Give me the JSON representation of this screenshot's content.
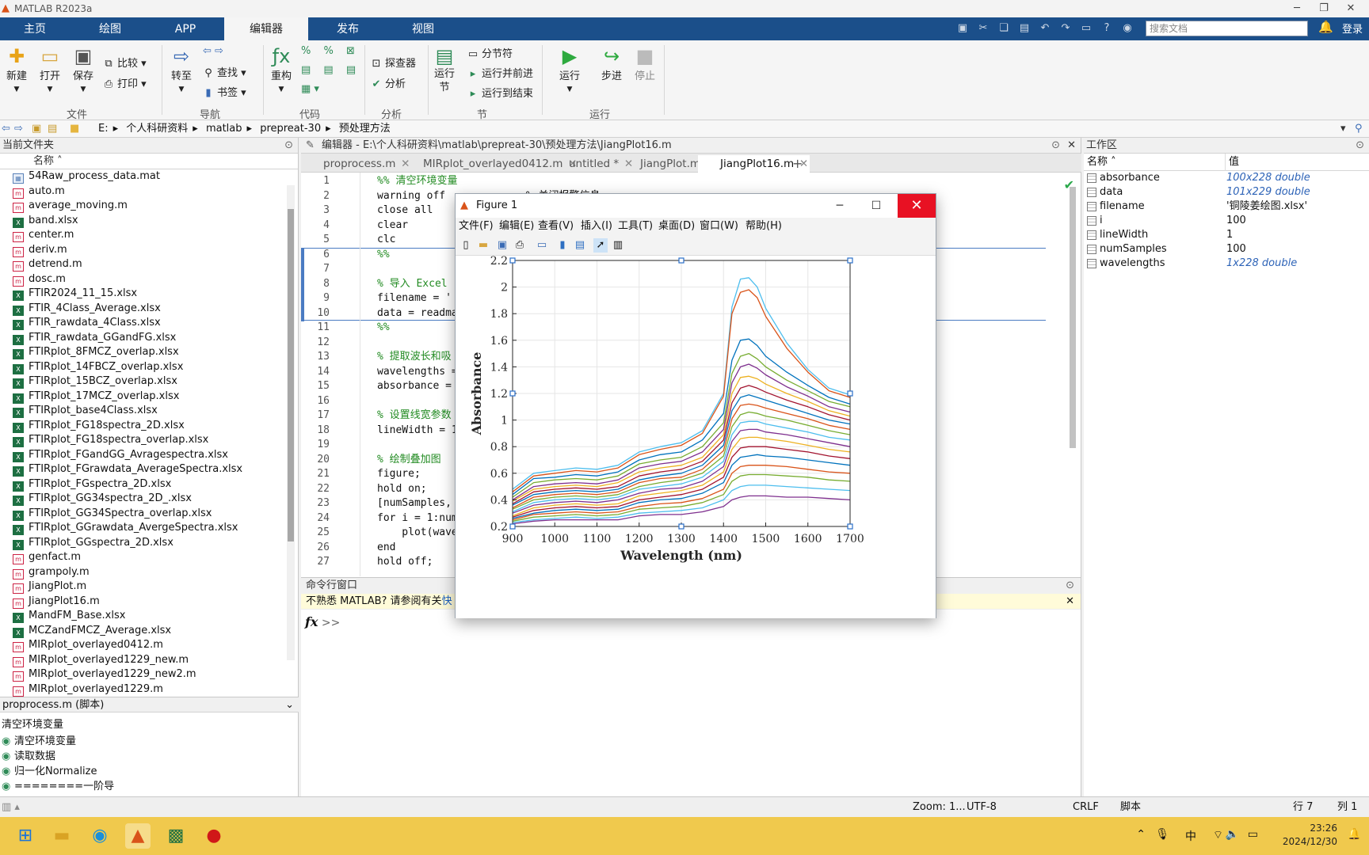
{
  "window": {
    "title": "MATLAB R2023a"
  },
  "ribbon_tabs": [
    "主页",
    "绘图",
    "APP",
    "编辑器",
    "发布",
    "视图"
  ],
  "active_tab": "编辑器",
  "search": {
    "placeholder": "搜索文档"
  },
  "login": "登录",
  "ribbon": {
    "file": {
      "group": "文件",
      "new": "新建",
      "open": "打开",
      "save": "保存",
      "compare": "比较",
      "print": "打印"
    },
    "nav": {
      "group": "导航",
      "goto": "转至",
      "find": "查找",
      "bookmark": "书签"
    },
    "code": {
      "group": "代码",
      "refactor": "重构"
    },
    "analyze": {
      "group": "分析",
      "profiler": "探查器",
      "analyze": "分析"
    },
    "section": {
      "group": "节",
      "run_section": "运行\n节",
      "break": "分节符",
      "run_advance": "运行并前进",
      "run_end": "运行到结束"
    },
    "run": {
      "group": "运行",
      "run": "运行",
      "step": "步进",
      "stop": "停止"
    }
  },
  "address": [
    "E:",
    "个人科研资料",
    "matlab",
    "prepreat-30",
    "预处理方法"
  ],
  "current_folder": {
    "title": "当前文件夹",
    "col_name": "名称",
    "files": [
      {
        "name": "54Raw_process_data.mat",
        "type": "t"
      },
      {
        "name": "auto.m",
        "type": "m"
      },
      {
        "name": "average_moving.m",
        "type": "m"
      },
      {
        "name": "band.xlsx",
        "type": "x"
      },
      {
        "name": "center.m",
        "type": "m"
      },
      {
        "name": "deriv.m",
        "type": "m"
      },
      {
        "name": "detrend.m",
        "type": "m"
      },
      {
        "name": "dosc.m",
        "type": "m"
      },
      {
        "name": "FTIR2024_11_15.xlsx",
        "type": "x"
      },
      {
        "name": "FTIR_4Class_Average.xlsx",
        "type": "x"
      },
      {
        "name": "FTIR_rawdata_4Class.xlsx",
        "type": "x"
      },
      {
        "name": "FTIR_rawdata_GGandFG.xlsx",
        "type": "x"
      },
      {
        "name": "FTIRplot_8FMCZ_overlap.xlsx",
        "type": "x"
      },
      {
        "name": "FTIRplot_14FBCZ_overlap.xlsx",
        "type": "x"
      },
      {
        "name": "FTIRplot_15BCZ_overlap.xlsx",
        "type": "x"
      },
      {
        "name": "FTIRplot_17MCZ_overlap.xlsx",
        "type": "x"
      },
      {
        "name": "FTIRplot_base4Class.xlsx",
        "type": "x"
      },
      {
        "name": "FTIRplot_FG18spectra_2D.xlsx",
        "type": "x"
      },
      {
        "name": "FTIRplot_FG18spectra_overlap.xlsx",
        "type": "x"
      },
      {
        "name": "FTIRplot_FGandGG_Avragespectra.xlsx",
        "type": "x"
      },
      {
        "name": "FTIRplot_FGrawdata_AverageSpectra.xlsx",
        "type": "x"
      },
      {
        "name": "FTIRplot_FGspectra_2D.xlsx",
        "type": "x"
      },
      {
        "name": "FTIRplot_GG34spectra_2D_.xlsx",
        "type": "x"
      },
      {
        "name": "FTIRplot_GG34Spectra_overlap.xlsx",
        "type": "x"
      },
      {
        "name": "FTIRplot_GGrawdata_AvergeSpectra.xlsx",
        "type": "x"
      },
      {
        "name": "FTIRplot_GGspectra_2D.xlsx",
        "type": "x"
      },
      {
        "name": "genfact.m",
        "type": "m"
      },
      {
        "name": "grampoly.m",
        "type": "m"
      },
      {
        "name": "JiangPlot.m",
        "type": "m"
      },
      {
        "name": "JiangPlot16.m",
        "type": "m"
      },
      {
        "name": "MandFM_Base.xlsx",
        "type": "x"
      },
      {
        "name": "MCZandFMCZ_Average.xlsx",
        "type": "x"
      },
      {
        "name": "MIRplot_overlayed0412.m",
        "type": "m"
      },
      {
        "name": "MIRplot_overlayed1229_new.m",
        "type": "m"
      },
      {
        "name": "MIRplot_overlayed1229_new2.m",
        "type": "m"
      },
      {
        "name": "MIRplot_overlayed1229.m",
        "type": "m"
      }
    ],
    "detail_title": "proprocess.m (脚本)",
    "outline_title": "清空环境变量",
    "outline": [
      "清空环境变量",
      "读取数据",
      "归一化Normalize",
      "========一阶导"
    ]
  },
  "editor": {
    "title": "编辑器 - E:\\个人科研资料\\matlab\\prepreat-30\\预处理方法\\JiangPlot16.m",
    "tabs": [
      "proprocess.m",
      "MIRplot_overlayed0412.m",
      "untitled *",
      "JiangPlot.m",
      "JiangPlot16.m"
    ],
    "active_tab": "JiangPlot16.m",
    "lines": [
      "%% 清空环境变量",
      "warning off             % 关闭报警信息",
      "close all",
      "clear",
      "clc",
      "%%",
      "",
      "% 导入 Excel",
      "filename = '",
      "data = readma",
      "%%",
      "",
      "% 提取波长和吸",
      "wavelengths =",
      "absorbance =",
      "",
      "% 设置线宽参数",
      "lineWidth = 1",
      "",
      "% 绘制叠加图",
      "figure;",
      "hold on;",
      "[numSamples,",
      "for i = 1:num",
      "    plot(wave",
      "end",
      "hold off;"
    ]
  },
  "command_window": {
    "title": "命令行窗口",
    "notice": "不熟悉 MATLAB? 请参阅有关",
    "notice_link": "快",
    "prompt": ">>"
  },
  "workspace": {
    "title": "工作区",
    "col_name": "名称",
    "col_value": "值",
    "vars": [
      {
        "name": "absorbance",
        "value": "100x228 double",
        "italic": true
      },
      {
        "name": "data",
        "value": "101x229 double",
        "italic": true
      },
      {
        "name": "filename",
        "value": "'铜陵姜绘图.xlsx'",
        "italic": false
      },
      {
        "name": "i",
        "value": "100",
        "italic": false
      },
      {
        "name": "lineWidth",
        "value": "1",
        "italic": false
      },
      {
        "name": "numSamples",
        "value": "100",
        "italic": false
      },
      {
        "name": "wavelengths",
        "value": "1x228 double",
        "italic": true
      }
    ]
  },
  "status": {
    "zoom": "Zoom: 1...",
    "encoding": "UTF-8",
    "eol": "CRLF",
    "type": "脚本",
    "row": "行 7",
    "col": "列 1"
  },
  "figure": {
    "title": "Figure 1",
    "menu": [
      "文件(F)",
      "编辑(E)",
      "查看(V)",
      "插入(I)",
      "工具(T)",
      "桌面(D)",
      "窗口(W)",
      "帮助(H)"
    ]
  },
  "chart_data": {
    "type": "line",
    "xlabel": "Wavelength (nm)",
    "ylabel": "Absorbance",
    "xlim": [
      900,
      1700
    ],
    "ylim": [
      0.2,
      2.2
    ],
    "xticks": [
      900,
      1000,
      1100,
      1200,
      1300,
      1400,
      1500,
      1600,
      1700
    ],
    "yticks": [
      0.2,
      0.4,
      0.6,
      0.8,
      1,
      1.2,
      1.4,
      1.6,
      1.8,
      2,
      2.2
    ],
    "grid": true,
    "x": [
      900,
      950,
      1000,
      1050,
      1100,
      1150,
      1200,
      1250,
      1300,
      1350,
      1400,
      1420,
      1440,
      1460,
      1480,
      1500,
      1550,
      1600,
      1650,
      1700
    ],
    "series": [
      {
        "color": "#4dbeee",
        "values": [
          0.48,
          0.6,
          0.62,
          0.64,
          0.63,
          0.66,
          0.76,
          0.8,
          0.83,
          0.92,
          1.2,
          1.85,
          2.06,
          2.07,
          2.0,
          1.84,
          1.58,
          1.38,
          1.24,
          1.19
        ]
      },
      {
        "color": "#d95319",
        "values": [
          0.46,
          0.58,
          0.6,
          0.62,
          0.61,
          0.64,
          0.74,
          0.78,
          0.81,
          0.9,
          1.18,
          1.8,
          1.96,
          1.98,
          1.92,
          1.78,
          1.54,
          1.36,
          1.22,
          1.17
        ]
      },
      {
        "color": "#0072bd",
        "values": [
          0.44,
          0.56,
          0.57,
          0.59,
          0.58,
          0.61,
          0.7,
          0.74,
          0.76,
          0.85,
          1.05,
          1.45,
          1.6,
          1.61,
          1.56,
          1.48,
          1.36,
          1.26,
          1.17,
          1.12
        ]
      },
      {
        "color": "#77ac30",
        "values": [
          0.42,
          0.53,
          0.55,
          0.56,
          0.55,
          0.58,
          0.67,
          0.7,
          0.72,
          0.8,
          0.98,
          1.35,
          1.48,
          1.5,
          1.46,
          1.4,
          1.3,
          1.22,
          1.14,
          1.1
        ]
      },
      {
        "color": "#7e2f8e",
        "values": [
          0.4,
          0.5,
          0.52,
          0.53,
          0.52,
          0.55,
          0.64,
          0.67,
          0.69,
          0.76,
          0.93,
          1.28,
          1.4,
          1.42,
          1.39,
          1.34,
          1.25,
          1.18,
          1.1,
          1.06
        ]
      },
      {
        "color": "#edb120",
        "values": [
          0.39,
          0.48,
          0.5,
          0.51,
          0.5,
          0.53,
          0.61,
          0.64,
          0.66,
          0.72,
          0.89,
          1.2,
          1.32,
          1.33,
          1.31,
          1.27,
          1.2,
          1.14,
          1.07,
          1.03
        ]
      },
      {
        "color": "#a2142f",
        "values": [
          0.37,
          0.46,
          0.48,
          0.49,
          0.48,
          0.5,
          0.58,
          0.61,
          0.63,
          0.69,
          0.85,
          1.13,
          1.24,
          1.26,
          1.24,
          1.21,
          1.15,
          1.1,
          1.04,
          1.0
        ]
      },
      {
        "color": "#0072bd",
        "values": [
          0.36,
          0.44,
          0.46,
          0.47,
          0.46,
          0.48,
          0.55,
          0.58,
          0.6,
          0.66,
          0.81,
          1.07,
          1.17,
          1.19,
          1.17,
          1.15,
          1.1,
          1.05,
          1.0,
          0.97
        ]
      },
      {
        "color": "#d95319",
        "values": [
          0.34,
          0.42,
          0.44,
          0.45,
          0.44,
          0.46,
          0.53,
          0.56,
          0.57,
          0.63,
          0.77,
          1.01,
          1.11,
          1.12,
          1.11,
          1.09,
          1.05,
          1.01,
          0.96,
          0.93
        ]
      },
      {
        "color": "#77ac30",
        "values": [
          0.33,
          0.4,
          0.42,
          0.43,
          0.42,
          0.44,
          0.5,
          0.53,
          0.55,
          0.6,
          0.73,
          0.95,
          1.04,
          1.06,
          1.05,
          1.03,
          1.0,
          0.96,
          0.92,
          0.89
        ]
      },
      {
        "color": "#4dbeee",
        "values": [
          0.31,
          0.38,
          0.4,
          0.41,
          0.4,
          0.42,
          0.48,
          0.5,
          0.52,
          0.57,
          0.69,
          0.89,
          0.98,
          0.99,
          0.99,
          0.97,
          0.94,
          0.91,
          0.87,
          0.85
        ]
      },
      {
        "color": "#7e2f8e",
        "values": [
          0.3,
          0.36,
          0.38,
          0.39,
          0.38,
          0.4,
          0.45,
          0.48,
          0.49,
          0.54,
          0.65,
          0.84,
          0.92,
          0.93,
          0.93,
          0.91,
          0.89,
          0.86,
          0.83,
          0.8
        ]
      },
      {
        "color": "#edb120",
        "values": [
          0.28,
          0.34,
          0.36,
          0.37,
          0.36,
          0.37,
          0.43,
          0.45,
          0.47,
          0.51,
          0.61,
          0.78,
          0.86,
          0.87,
          0.87,
          0.86,
          0.84,
          0.81,
          0.78,
          0.76
        ]
      },
      {
        "color": "#a2142f",
        "values": [
          0.27,
          0.32,
          0.34,
          0.35,
          0.34,
          0.35,
          0.4,
          0.42,
          0.44,
          0.48,
          0.57,
          0.72,
          0.79,
          0.8,
          0.8,
          0.8,
          0.78,
          0.76,
          0.73,
          0.71
        ]
      },
      {
        "color": "#0072bd",
        "values": [
          0.26,
          0.3,
          0.32,
          0.33,
          0.32,
          0.33,
          0.38,
          0.4,
          0.41,
          0.45,
          0.53,
          0.66,
          0.72,
          0.73,
          0.74,
          0.73,
          0.72,
          0.7,
          0.68,
          0.66
        ]
      },
      {
        "color": "#d95319",
        "values": [
          0.25,
          0.29,
          0.3,
          0.31,
          0.3,
          0.31,
          0.35,
          0.37,
          0.38,
          0.41,
          0.48,
          0.6,
          0.65,
          0.66,
          0.66,
          0.66,
          0.65,
          0.63,
          0.61,
          0.6
        ]
      },
      {
        "color": "#77ac30",
        "values": [
          0.24,
          0.27,
          0.28,
          0.29,
          0.28,
          0.29,
          0.33,
          0.34,
          0.35,
          0.38,
          0.44,
          0.54,
          0.58,
          0.59,
          0.59,
          0.59,
          0.58,
          0.57,
          0.55,
          0.54
        ]
      },
      {
        "color": "#4dbeee",
        "values": [
          0.23,
          0.25,
          0.26,
          0.27,
          0.26,
          0.27,
          0.3,
          0.31,
          0.32,
          0.34,
          0.4,
          0.47,
          0.5,
          0.51,
          0.51,
          0.51,
          0.5,
          0.49,
          0.48,
          0.47
        ]
      },
      {
        "color": "#7e2f8e",
        "values": [
          0.22,
          0.24,
          0.25,
          0.25,
          0.25,
          0.25,
          0.28,
          0.29,
          0.29,
          0.31,
          0.35,
          0.4,
          0.42,
          0.43,
          0.43,
          0.43,
          0.42,
          0.42,
          0.41,
          0.4
        ]
      }
    ]
  }
}
